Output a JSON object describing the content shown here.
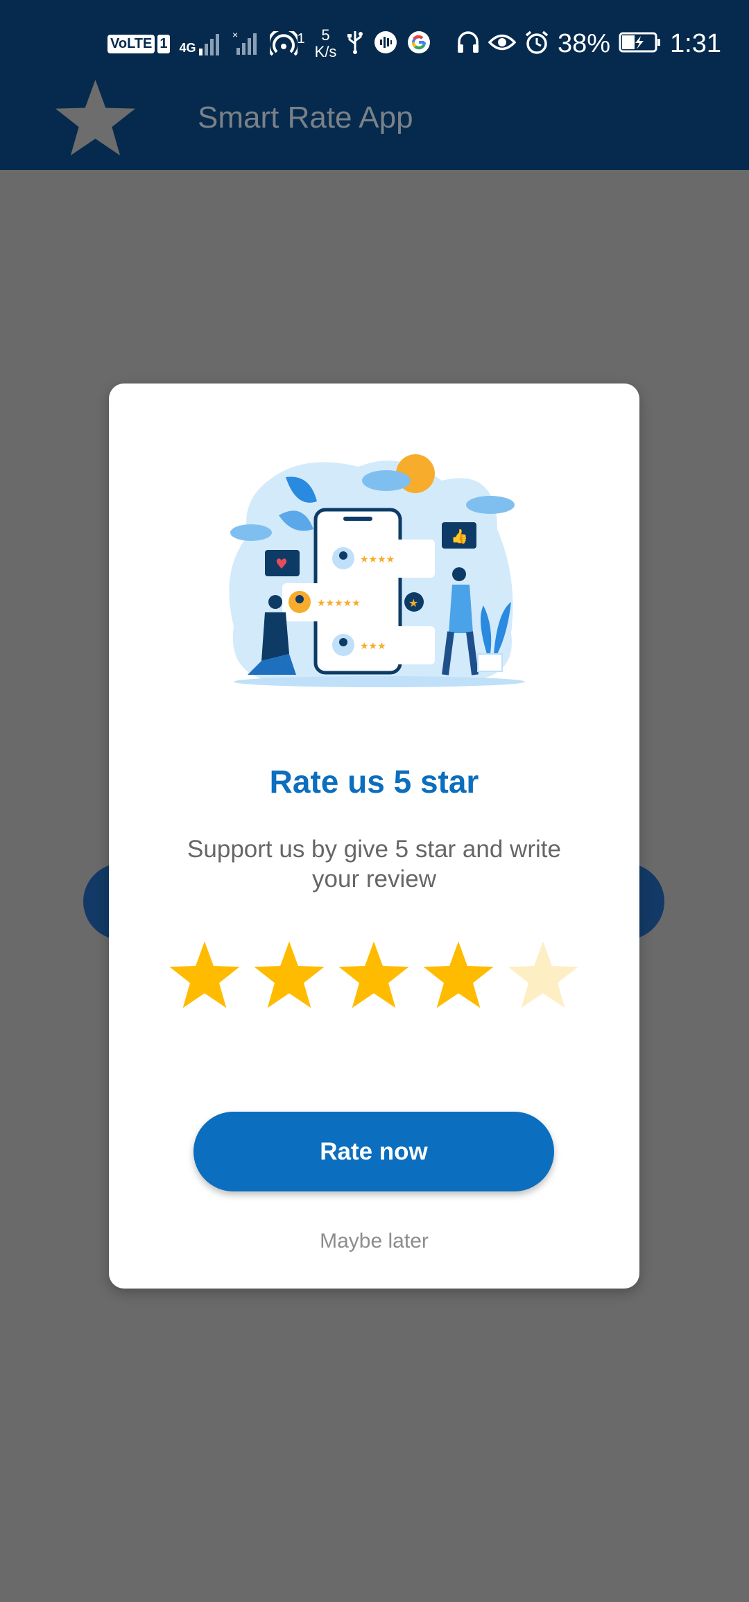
{
  "status_bar": {
    "volte": "VoLTE",
    "sim": "1",
    "network": "4G",
    "hotspot_count": "1",
    "speed_value": "5",
    "speed_unit": "K/s",
    "battery": "38%",
    "time": "1:31"
  },
  "app": {
    "title": "Smart Rate App"
  },
  "dialog": {
    "title": "Rate us 5 star",
    "subtitle": "Support us by give 5 star and write your review",
    "rating": 4,
    "max_rating": 5,
    "rate_button": "Rate now",
    "later_link": "Maybe later"
  },
  "colors": {
    "primary": "#0b6ebe",
    "app_bar": "#052a4d",
    "star_filled": "#ffbb00",
    "star_empty": "#fdeec4",
    "overlay": "#6a6a6a"
  }
}
